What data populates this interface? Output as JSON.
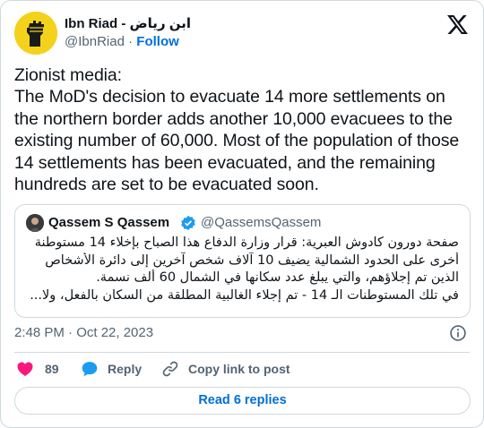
{
  "author": {
    "display_name": "Ibn Riad - ابن رياض",
    "handle": "@IbnRiad",
    "separator": "·",
    "follow_label": "Follow"
  },
  "tweet": {
    "text": "Zionist media:\nThe MoD's decision to evacuate 14 more settlements on the northern border adds another 10,000 evacuees to the existing number of 60,000. Most of the population of those 14 settlements has been evacuated, and the remaining hundreds are set to be evacuated soon."
  },
  "quoted": {
    "display_name": "Qassem S Qassem",
    "handle": "@QassemsQassem",
    "lines": [
      "صفحة دورون كادوش العبرية: قرار وزارة الدفاع هذا الصباح بإخلاء 14 مستوطنة",
      "أخرى على الحدود الشمالية يضيف 10 آلاف شخص آخرين إلى دائرة الأشخاص",
      "الذين تم إجلاؤهم، والتي يبلغ عدد سكانها في الشمال 60 ألف نسمة.",
      "في تلك المستوطنات الـ 14 - تم إجلاء الغالبية المطلقة من السكان بالفعل، ولا..."
    ]
  },
  "meta": {
    "timestamp": "2:48 PM · Oct 22, 2023"
  },
  "actions": {
    "like_count": "89",
    "reply_label": "Reply",
    "copy_label": "Copy link to post"
  },
  "read_replies_label": "Read 6 replies",
  "colors": {
    "link": "#006fd6",
    "like": "#f91880",
    "reply": "#1d9bf0",
    "muted": "#536471",
    "border": "#cfd9de",
    "avatar_bg": "#f4d21c"
  },
  "icons": {
    "brand": "x-logo-icon",
    "verified": "verified-badge-icon",
    "info": "info-icon",
    "like": "heart-icon",
    "reply": "speech-bubble-icon",
    "copy": "link-icon"
  }
}
